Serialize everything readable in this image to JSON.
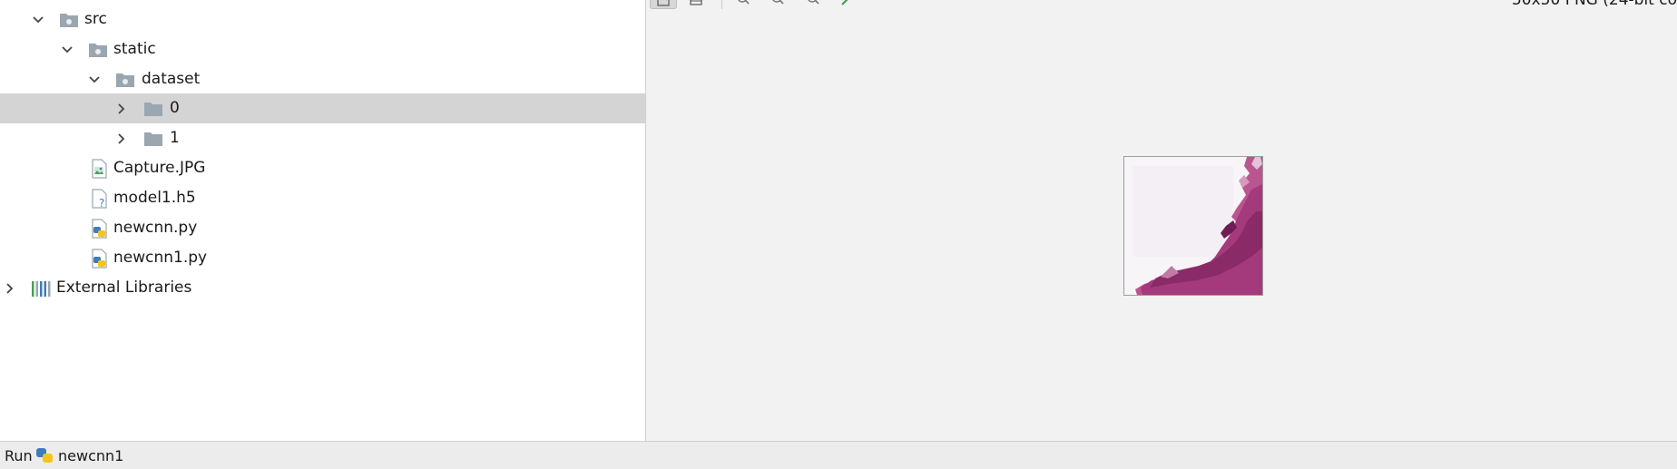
{
  "project_tree": {
    "items": [
      {
        "label": "src",
        "icon": "folder-icon",
        "expanded": true
      },
      {
        "label": "static",
        "icon": "folder-icon",
        "expanded": true
      },
      {
        "label": "dataset",
        "icon": "folder-icon",
        "expanded": true
      },
      {
        "label": "0",
        "icon": "folder-icon",
        "expanded": false,
        "selected": true
      },
      {
        "label": "1",
        "icon": "folder-icon",
        "expanded": false
      },
      {
        "label": "Capture.JPG",
        "icon": "image-file-icon"
      },
      {
        "label": "model1.h5",
        "icon": "unknown-file-icon"
      },
      {
        "label": "newcnn.py",
        "icon": "python-file-icon"
      },
      {
        "label": "newcnn1.py",
        "icon": "python-file-icon"
      },
      {
        "label": "External Libraries",
        "icon": "libraries-icon",
        "expanded": false
      }
    ]
  },
  "image_viewer": {
    "info_text": "50x50 PNG (24-bit co"
  },
  "status_bar": {
    "run_label": "Run",
    "config_name": "newcnn1"
  },
  "colors": {
    "selection": "#d4d4d4",
    "folder": "#9aa7b0",
    "python_blue": "#3e7bbd",
    "python_yellow": "#f5c518",
    "tissue": "#a43a7c"
  }
}
